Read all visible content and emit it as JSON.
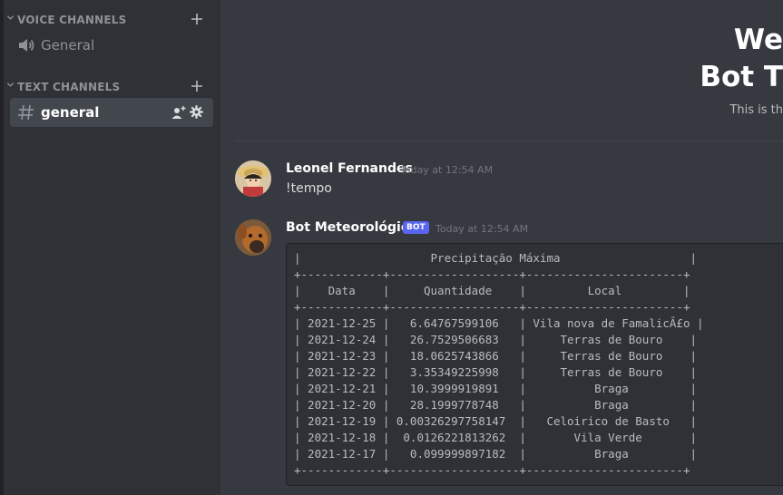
{
  "sidebar": {
    "voice_category": "VOICE CHANNELS",
    "voice_channels": [
      {
        "name": "General"
      }
    ],
    "text_category": "TEXT CHANNELS",
    "text_channels": [
      {
        "name": "general",
        "active": true
      }
    ]
  },
  "header": {
    "welcome_line1": "We",
    "welcome_line2": "Bot T",
    "welcome_sub": "This is th"
  },
  "messages": [
    {
      "author": "Leonel Fernandes",
      "timestamp": "Today at 12:54 AM",
      "content": "!tempo"
    },
    {
      "author": "Bot Meteorológico",
      "badge": "BOT",
      "timestamp": "Today at 12:54 AM",
      "code": "|                   Precipitação Máxima                   |\n+------------+-------------------+-----------------------+\n|    Data    |     Quantidade    |         Local         |\n+------------+-------------------+-----------------------+\n| 2021-12-25 |   6.64767599106   | Vila nova de FamalicÃ£o |\n| 2021-12-24 |   26.7529506683   |     Terras de Bouro    |\n| 2021-12-23 |   18.0625743866   |     Terras de Bouro    |\n| 2021-12-22 |   3.35349225998   |     Terras de Bouro    |\n| 2021-12-21 |   10.3999919891   |          Braga         |\n| 2021-12-20 |   28.1999778748   |          Braga         |\n| 2021-12-19 | 0.00326297758147  |   Celoirico de Basto   |\n| 2021-12-18 |  0.0126221813262  |       Vila Verde       |\n| 2021-12-17 |   0.099999897182  |          Braga         |\n+------------+-------------------+-----------------------+"
    }
  ],
  "colors": {
    "accent": "#5865f2",
    "background": "#36393f",
    "sidebar": "#2f3136"
  }
}
